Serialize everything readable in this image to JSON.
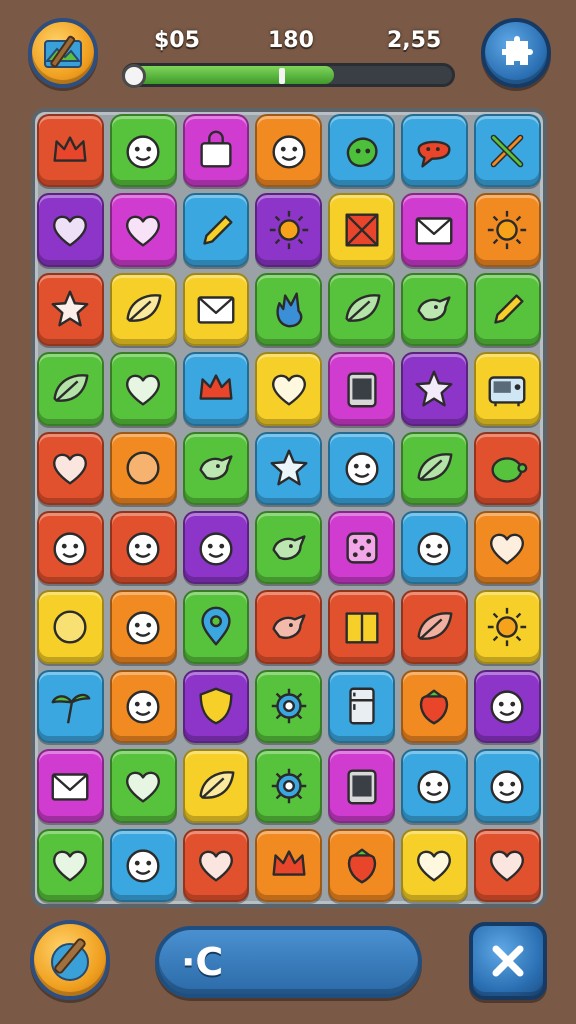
{
  "hud": {
    "left_value": "$05",
    "center_value": "180",
    "right_value": "2,55",
    "progress_fraction": 0.64
  },
  "bottom": {
    "action_label": "·C"
  },
  "colors": {
    "red": "#e2512d",
    "green": "#57c23c",
    "magenta": "#cf3ccf",
    "orange": "#f28a22",
    "blue": "#3aa7e0",
    "purple": "#8c35c8",
    "yellow": "#f6d028",
    "board": "#9aa2a8"
  },
  "board": {
    "rows": [
      [
        {
          "c": "red",
          "i": "crown"
        },
        {
          "c": "green",
          "i": "face"
        },
        {
          "c": "magenta",
          "i": "bag"
        },
        {
          "c": "orange",
          "i": "face"
        },
        {
          "c": "blue",
          "i": "blob"
        },
        {
          "c": "blue",
          "i": "chat"
        },
        {
          "c": "blue",
          "i": "tools"
        }
      ],
      [
        {
          "c": "purple",
          "i": "heart"
        },
        {
          "c": "magenta",
          "i": "heart"
        },
        {
          "c": "blue",
          "i": "pencil"
        },
        {
          "c": "purple",
          "i": "sun"
        },
        {
          "c": "yellow",
          "i": "box"
        },
        {
          "c": "magenta",
          "i": "envelope"
        },
        {
          "c": "orange",
          "i": "sun"
        }
      ],
      [
        {
          "c": "red",
          "i": "star"
        },
        {
          "c": "yellow",
          "i": "leaf"
        },
        {
          "c": "yellow",
          "i": "envelope"
        },
        {
          "c": "green",
          "i": "flame"
        },
        {
          "c": "green",
          "i": "leaf"
        },
        {
          "c": "green",
          "i": "bird"
        },
        {
          "c": "green",
          "i": "pencil"
        }
      ],
      [
        {
          "c": "green",
          "i": "leaf"
        },
        {
          "c": "green",
          "i": "heart"
        },
        {
          "c": "blue",
          "i": "crown"
        },
        {
          "c": "yellow",
          "i": "heart"
        },
        {
          "c": "magenta",
          "i": "tablet"
        },
        {
          "c": "purple",
          "i": "star"
        },
        {
          "c": "yellow",
          "i": "radio"
        }
      ],
      [
        {
          "c": "red",
          "i": "heart"
        },
        {
          "c": "orange",
          "i": "circle"
        },
        {
          "c": "green",
          "i": "bird"
        },
        {
          "c": "blue",
          "i": "star"
        },
        {
          "c": "blue",
          "i": "face"
        },
        {
          "c": "green",
          "i": "leaf"
        },
        {
          "c": "red",
          "i": "turtle"
        }
      ],
      [
        {
          "c": "red",
          "i": "face"
        },
        {
          "c": "red",
          "i": "face"
        },
        {
          "c": "purple",
          "i": "face"
        },
        {
          "c": "green",
          "i": "bird"
        },
        {
          "c": "magenta",
          "i": "dice"
        },
        {
          "c": "blue",
          "i": "face"
        },
        {
          "c": "orange",
          "i": "heart"
        }
      ],
      [
        {
          "c": "yellow",
          "i": "circle"
        },
        {
          "c": "orange",
          "i": "face"
        },
        {
          "c": "green",
          "i": "pin"
        },
        {
          "c": "red",
          "i": "bird"
        },
        {
          "c": "red",
          "i": "book"
        },
        {
          "c": "red",
          "i": "leaf"
        },
        {
          "c": "yellow",
          "i": "sun"
        }
      ],
      [
        {
          "c": "blue",
          "i": "palm"
        },
        {
          "c": "orange",
          "i": "face"
        },
        {
          "c": "purple",
          "i": "shield"
        },
        {
          "c": "green",
          "i": "gear"
        },
        {
          "c": "blue",
          "i": "fridge"
        },
        {
          "c": "orange",
          "i": "strawberry"
        },
        {
          "c": "purple",
          "i": "face"
        }
      ],
      [
        {
          "c": "magenta",
          "i": "envelope"
        },
        {
          "c": "green",
          "i": "heart"
        },
        {
          "c": "yellow",
          "i": "leaf"
        },
        {
          "c": "green",
          "i": "gear"
        },
        {
          "c": "magenta",
          "i": "tablet"
        },
        {
          "c": "blue",
          "i": "face"
        },
        {
          "c": "blue",
          "i": "face"
        }
      ],
      [
        {
          "c": "green",
          "i": "heart"
        },
        {
          "c": "blue",
          "i": "face"
        },
        {
          "c": "red",
          "i": "heart"
        },
        {
          "c": "orange",
          "i": "crown"
        },
        {
          "c": "orange",
          "i": "strawberry"
        },
        {
          "c": "yellow",
          "i": "heart"
        },
        {
          "c": "red",
          "i": "heart"
        }
      ]
    ]
  }
}
